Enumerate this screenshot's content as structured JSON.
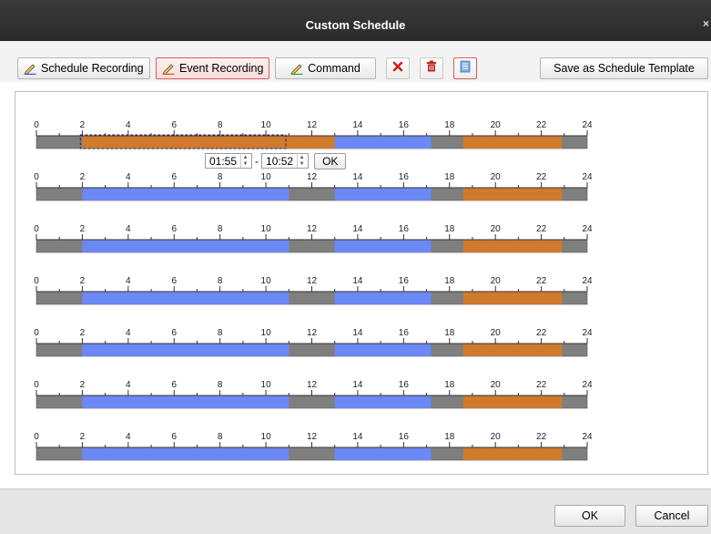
{
  "window": {
    "title": "Custom Schedule",
    "close_glyph": "×"
  },
  "toolbar": {
    "schedule_recording_label": "Schedule Recording",
    "event_recording_label": "Event Recording",
    "command_label": "Command",
    "save_template_label": "Save as Schedule Template",
    "active_mode": "Event Recording"
  },
  "timeline": {
    "hour_labels": [
      "0",
      "2",
      "4",
      "6",
      "8",
      "10",
      "12",
      "14",
      "16",
      "18",
      "20",
      "22",
      "24"
    ],
    "colors": {
      "empty": "#7f7f7f",
      "schedule": "#6b88f5",
      "event": "#d07a2c",
      "command": "#5e9a3a"
    },
    "rows": [
      {
        "segments": [
          {
            "start": 2,
            "end": 13,
            "type": "event"
          },
          {
            "start": 13,
            "end": 17.2,
            "type": "schedule"
          },
          {
            "start": 18.6,
            "end": 22.9,
            "type": "event"
          }
        ],
        "selection": {
          "start": 1.917,
          "end": 10.867
        }
      },
      {
        "segments": [
          {
            "start": 2,
            "end": 11,
            "type": "schedule"
          },
          {
            "start": 13,
            "end": 17.2,
            "type": "schedule"
          },
          {
            "start": 18.6,
            "end": 22.9,
            "type": "event"
          }
        ]
      },
      {
        "segments": [
          {
            "start": 2,
            "end": 11,
            "type": "schedule"
          },
          {
            "start": 13,
            "end": 17.2,
            "type": "schedule"
          },
          {
            "start": 18.6,
            "end": 22.9,
            "type": "event"
          }
        ]
      },
      {
        "segments": [
          {
            "start": 2,
            "end": 11,
            "type": "schedule"
          },
          {
            "start": 13,
            "end": 17.2,
            "type": "schedule"
          },
          {
            "start": 18.6,
            "end": 22.9,
            "type": "event"
          }
        ]
      },
      {
        "segments": [
          {
            "start": 2,
            "end": 11,
            "type": "schedule"
          },
          {
            "start": 13,
            "end": 17.2,
            "type": "schedule"
          },
          {
            "start": 18.6,
            "end": 22.9,
            "type": "event"
          }
        ]
      },
      {
        "segments": [
          {
            "start": 2,
            "end": 11,
            "type": "schedule"
          },
          {
            "start": 13,
            "end": 17.2,
            "type": "schedule"
          },
          {
            "start": 18.6,
            "end": 22.9,
            "type": "event"
          }
        ]
      },
      {
        "segments": [
          {
            "start": 2,
            "end": 11,
            "type": "schedule"
          },
          {
            "start": 13,
            "end": 17.2,
            "type": "schedule"
          },
          {
            "start": 18.6,
            "end": 22.9,
            "type": "event"
          }
        ]
      }
    ]
  },
  "time_editor": {
    "start_time": "01:55",
    "end_time": "10:52",
    "separator": "-",
    "ok_label": "OK",
    "spin_up": "▲",
    "spin_down": "▼"
  },
  "footer": {
    "ok_label": "OK",
    "cancel_label": "Cancel"
  }
}
